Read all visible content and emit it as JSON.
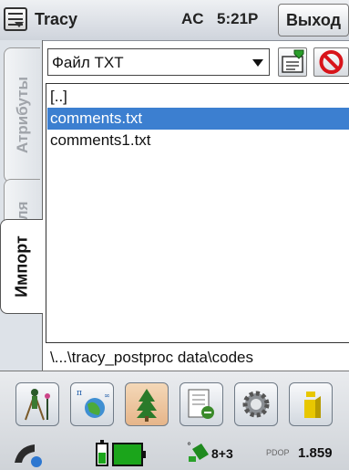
{
  "titlebar": {
    "app_title": "Tracy",
    "power_status": "AC",
    "clock": "5:21P",
    "exit_label": "Выход"
  },
  "tabs": [
    {
      "label": "Атрибуты",
      "active": false
    },
    {
      "label": "Поля",
      "active": false
    },
    {
      "label": "Импорт",
      "active": true
    }
  ],
  "file_type": {
    "selected": "Файл TXT"
  },
  "file_list": {
    "items": [
      "[..]",
      "comments.txt",
      "comments1.txt"
    ],
    "selected_index": 1
  },
  "path": "\\...\\tracy_postproc data\\codes",
  "toolbar": {
    "tools": [
      "surveyor-icon",
      "globe-transform-icon",
      "tree-icon",
      "notebook-connect-icon",
      "gear-icon",
      "info-icon"
    ],
    "active_index": 2
  },
  "statusbar": {
    "satellites": "8+3",
    "pdop_label": "PDOP",
    "pdop_value": "1.859"
  },
  "colors": {
    "selection": "#3c7fd0",
    "cancel_red": "#d8141a",
    "battery_green": "#1ba51b"
  }
}
